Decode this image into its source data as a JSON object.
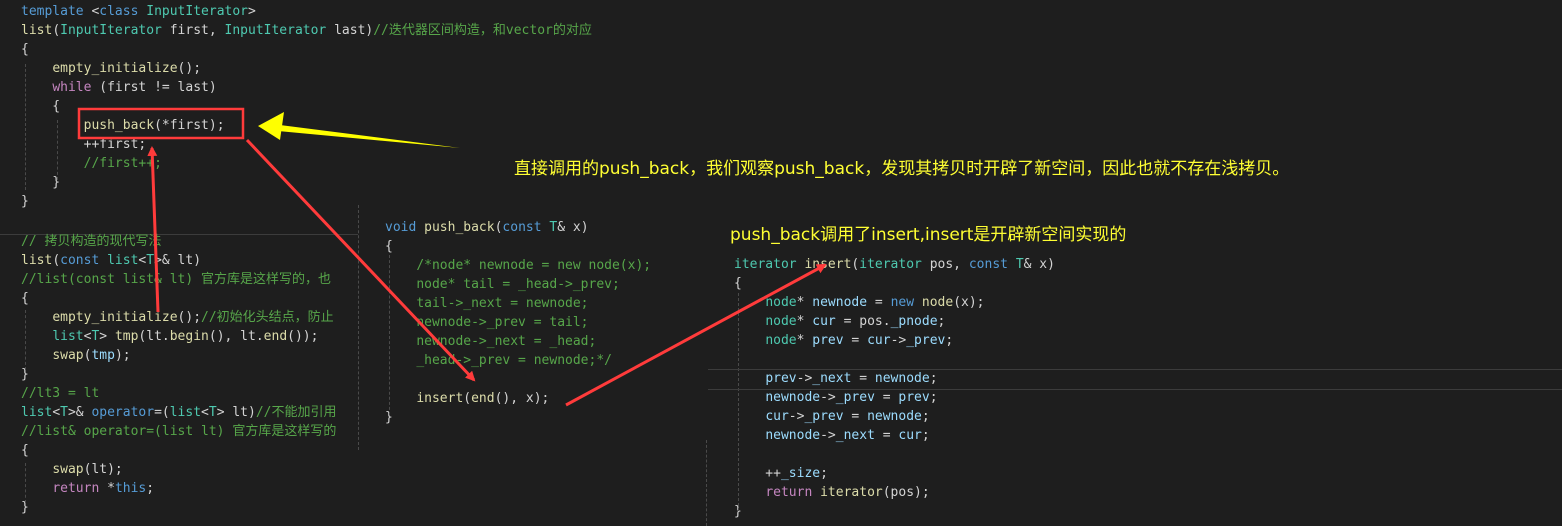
{
  "left_panel": {
    "lines": [
      {
        "parts": [
          [
            "kw",
            "template"
          ],
          [
            "plain",
            " <"
          ],
          [
            "kw",
            "class"
          ],
          [
            "plain",
            " "
          ],
          [
            "ty",
            "InputIterator"
          ],
          [
            "plain",
            ">"
          ]
        ]
      },
      {
        "parts": [
          [
            "fn",
            "list"
          ],
          [
            "plain",
            "("
          ],
          [
            "ty",
            "InputIterator"
          ],
          [
            "plain",
            " first, "
          ],
          [
            "ty",
            "InputIterator"
          ],
          [
            "plain",
            " last)"
          ],
          [
            "cm",
            "//迭代器区间构造，和vector的对应"
          ]
        ]
      },
      {
        "parts": [
          [
            "plain",
            "{"
          ]
        ]
      },
      {
        "parts": [
          [
            "plain",
            "    "
          ],
          [
            "fn",
            "empty_initialize"
          ],
          [
            "plain",
            "();"
          ]
        ]
      },
      {
        "parts": [
          [
            "plain",
            "    "
          ],
          [
            "kw2",
            "while"
          ],
          [
            "plain",
            " (first != last)"
          ]
        ]
      },
      {
        "parts": [
          [
            "plain",
            "    {"
          ]
        ]
      },
      {
        "parts": [
          [
            "plain",
            "        "
          ],
          [
            "fn",
            "push_back"
          ],
          [
            "plain",
            "(*first);"
          ]
        ]
      },
      {
        "parts": [
          [
            "plain",
            "        ++first;"
          ]
        ]
      },
      {
        "parts": [
          [
            "plain",
            "        "
          ],
          [
            "cm",
            "//first++;"
          ]
        ]
      },
      {
        "parts": [
          [
            "plain",
            "    }"
          ]
        ]
      },
      {
        "parts": [
          [
            "plain",
            "}"
          ]
        ]
      }
    ],
    "lines2": [
      {
        "parts": [
          [
            "cm",
            "// 拷贝构造的现代写法"
          ]
        ]
      },
      {
        "parts": [
          [
            "fn",
            "list"
          ],
          [
            "plain",
            "("
          ],
          [
            "kw",
            "const"
          ],
          [
            "plain",
            " "
          ],
          [
            "ty",
            "list"
          ],
          [
            "plain",
            "<"
          ],
          [
            "ty",
            "T"
          ],
          [
            "plain",
            ">& lt)"
          ]
        ]
      },
      {
        "parts": [
          [
            "cm",
            "//list(const list& lt) 官方库是这样写的，也"
          ]
        ]
      },
      {
        "parts": [
          [
            "plain",
            "{"
          ]
        ]
      },
      {
        "parts": [
          [
            "plain",
            "    "
          ],
          [
            "fn",
            "empty_initialize"
          ],
          [
            "plain",
            "();"
          ],
          [
            "cm",
            "//初始化头结点，防止"
          ]
        ]
      },
      {
        "parts": [
          [
            "plain",
            "    "
          ],
          [
            "ty",
            "list"
          ],
          [
            "plain",
            "<"
          ],
          [
            "ty",
            "T"
          ],
          [
            "plain",
            "> "
          ],
          [
            "fn",
            "tmp"
          ],
          [
            "plain",
            "(lt."
          ],
          [
            "fn",
            "begin"
          ],
          [
            "plain",
            "(), lt."
          ],
          [
            "fn",
            "end"
          ],
          [
            "plain",
            "());"
          ]
        ]
      },
      {
        "parts": [
          [
            "plain",
            "    "
          ],
          [
            "fn",
            "swap"
          ],
          [
            "plain",
            "("
          ],
          [
            "id",
            "tmp"
          ],
          [
            "plain",
            ");"
          ]
        ]
      },
      {
        "parts": [
          [
            "plain",
            "}"
          ]
        ]
      },
      {
        "parts": [
          [
            "cm",
            "//lt3 = lt"
          ]
        ]
      },
      {
        "parts": [
          [
            "ty",
            "list"
          ],
          [
            "plain",
            "<"
          ],
          [
            "ty",
            "T"
          ],
          [
            "plain",
            ">& "
          ],
          [
            "kw",
            "operator"
          ],
          [
            "plain",
            "=("
          ],
          [
            "ty",
            "list"
          ],
          [
            "plain",
            "<"
          ],
          [
            "ty",
            "T"
          ],
          [
            "plain",
            "> lt)"
          ],
          [
            "cm",
            "//不能加引用"
          ]
        ]
      },
      {
        "parts": [
          [
            "cm",
            "//list& operator=(list lt) 官方库是这样写的"
          ]
        ]
      },
      {
        "parts": [
          [
            "plain",
            "{"
          ]
        ]
      },
      {
        "parts": [
          [
            "plain",
            "    "
          ],
          [
            "fn",
            "swap"
          ],
          [
            "plain",
            "(lt);"
          ]
        ]
      },
      {
        "parts": [
          [
            "plain",
            "    "
          ],
          [
            "kw2",
            "return"
          ],
          [
            "plain",
            " *"
          ],
          [
            "kw",
            "this"
          ],
          [
            "plain",
            ";"
          ]
        ]
      },
      {
        "parts": [
          [
            "plain",
            "}"
          ]
        ]
      }
    ]
  },
  "middle_panel": {
    "lines": [
      {
        "parts": [
          [
            "kw",
            "void"
          ],
          [
            "plain",
            " "
          ],
          [
            "fn",
            "push_back"
          ],
          [
            "plain",
            "("
          ],
          [
            "kw",
            "const"
          ],
          [
            "plain",
            " "
          ],
          [
            "ty",
            "T"
          ],
          [
            "plain",
            "& x)"
          ]
        ]
      },
      {
        "parts": [
          [
            "plain",
            "{"
          ]
        ]
      },
      {
        "parts": [
          [
            "plain",
            "    "
          ],
          [
            "cm",
            "/*node* newnode = new node(x);"
          ]
        ]
      },
      {
        "parts": [
          [
            "plain",
            "    "
          ],
          [
            "cm",
            "node* tail = _head->_prev;"
          ]
        ]
      },
      {
        "parts": [
          [
            "plain",
            "    "
          ],
          [
            "cm",
            "tail->_next = newnode;"
          ]
        ]
      },
      {
        "parts": [
          [
            "plain",
            "    "
          ],
          [
            "cm",
            "newnode->_prev = tail;"
          ]
        ]
      },
      {
        "parts": [
          [
            "plain",
            "    "
          ],
          [
            "cm",
            "newnode->_next = _head;"
          ]
        ]
      },
      {
        "parts": [
          [
            "plain",
            "    "
          ],
          [
            "cm",
            "_head->_prev = newnode;*/"
          ]
        ]
      },
      {
        "parts": [
          [
            "plain",
            ""
          ]
        ]
      },
      {
        "parts": [
          [
            "plain",
            "    "
          ],
          [
            "fn",
            "insert"
          ],
          [
            "plain",
            "("
          ],
          [
            "fn",
            "end"
          ],
          [
            "plain",
            "(), x);"
          ]
        ]
      },
      {
        "parts": [
          [
            "plain",
            "}"
          ]
        ]
      }
    ]
  },
  "right_panel": {
    "lines": [
      {
        "parts": [
          [
            "ty",
            "iterator"
          ],
          [
            "plain",
            " "
          ],
          [
            "fn",
            "insert"
          ],
          [
            "plain",
            "("
          ],
          [
            "ty",
            "iterator"
          ],
          [
            "plain",
            " pos, "
          ],
          [
            "kw",
            "const"
          ],
          [
            "plain",
            " "
          ],
          [
            "ty",
            "T"
          ],
          [
            "plain",
            "& x)"
          ]
        ]
      },
      {
        "parts": [
          [
            "plain",
            "{"
          ]
        ]
      },
      {
        "parts": [
          [
            "plain",
            "    "
          ],
          [
            "ty",
            "node"
          ],
          [
            "plain",
            "* "
          ],
          [
            "id",
            "newnode"
          ],
          [
            "plain",
            " = "
          ],
          [
            "kw",
            "new"
          ],
          [
            "plain",
            " "
          ],
          [
            "fn",
            "node"
          ],
          [
            "plain",
            "(x);"
          ]
        ]
      },
      {
        "parts": [
          [
            "plain",
            "    "
          ],
          [
            "ty",
            "node"
          ],
          [
            "plain",
            "* "
          ],
          [
            "id",
            "cur"
          ],
          [
            "plain",
            " = pos."
          ],
          [
            "id",
            "_pnode"
          ],
          [
            "plain",
            ";"
          ]
        ]
      },
      {
        "parts": [
          [
            "plain",
            "    "
          ],
          [
            "ty",
            "node"
          ],
          [
            "plain",
            "* "
          ],
          [
            "id",
            "prev"
          ],
          [
            "plain",
            " = "
          ],
          [
            "id",
            "cur"
          ],
          [
            "plain",
            "->"
          ],
          [
            "id",
            "_prev"
          ],
          [
            "plain",
            ";"
          ]
        ]
      },
      {
        "parts": [
          [
            "plain",
            ""
          ]
        ]
      },
      {
        "parts": [
          [
            "plain",
            "    "
          ],
          [
            "id",
            "prev"
          ],
          [
            "plain",
            "->"
          ],
          [
            "id",
            "_next"
          ],
          [
            "plain",
            " = "
          ],
          [
            "id",
            "newnode"
          ],
          [
            "plain",
            ";"
          ]
        ]
      },
      {
        "parts": [
          [
            "plain",
            "    "
          ],
          [
            "id",
            "newnode"
          ],
          [
            "plain",
            "->"
          ],
          [
            "id",
            "_prev"
          ],
          [
            "plain",
            " = "
          ],
          [
            "id",
            "prev"
          ],
          [
            "plain",
            ";"
          ]
        ]
      },
      {
        "parts": [
          [
            "plain",
            "    "
          ],
          [
            "id",
            "cur"
          ],
          [
            "plain",
            "->"
          ],
          [
            "id",
            "_prev"
          ],
          [
            "plain",
            " = "
          ],
          [
            "id",
            "newnode"
          ],
          [
            "plain",
            ";"
          ]
        ]
      },
      {
        "parts": [
          [
            "plain",
            "    "
          ],
          [
            "id",
            "newnode"
          ],
          [
            "plain",
            "->"
          ],
          [
            "id",
            "_next"
          ],
          [
            "plain",
            " = "
          ],
          [
            "id",
            "cur"
          ],
          [
            "plain",
            ";"
          ]
        ]
      },
      {
        "parts": [
          [
            "plain",
            ""
          ]
        ]
      },
      {
        "parts": [
          [
            "plain",
            "    ++"
          ],
          [
            "id",
            "_size"
          ],
          [
            "plain",
            ";"
          ]
        ]
      },
      {
        "parts": [
          [
            "plain",
            "    "
          ],
          [
            "kw2",
            "return"
          ],
          [
            "plain",
            " "
          ],
          [
            "fn",
            "iterator"
          ],
          [
            "plain",
            "(pos);"
          ]
        ]
      },
      {
        "parts": [
          [
            "plain",
            "}"
          ]
        ]
      }
    ]
  },
  "annotations": {
    "note1": "直接调用的push_back，我们观察push_back，发现其拷贝时开辟了新空间，因此也就不存在浅拷贝。",
    "note2": "push_back调用了insert,insert是开辟新空间实现的"
  },
  "colors": {
    "arrow_yellow": "#ffff00",
    "arrow_red": "#ff3b3b",
    "note_text": "#ffff33"
  }
}
